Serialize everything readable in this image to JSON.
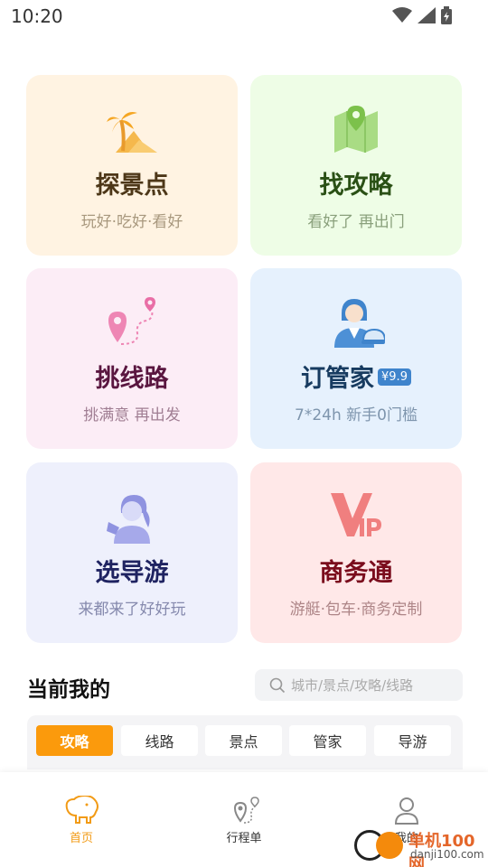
{
  "status_bar": {
    "time": "10:20"
  },
  "cards": [
    {
      "title": "探景点",
      "subtitle": "玩好·吃好·看好",
      "icon": "palm-tree-mountain-icon"
    },
    {
      "title": "找攻略",
      "subtitle": "看好了 再出门",
      "icon": "map-pin-icon"
    },
    {
      "title": "挑线路",
      "subtitle": "挑满意 再出发",
      "icon": "route-icon"
    },
    {
      "title": "订管家",
      "badge": "¥9.9",
      "subtitle": "7*24h 新手0门槛",
      "icon": "concierge-icon"
    },
    {
      "title": "选导游",
      "subtitle": "来都来了好好玩",
      "icon": "guide-icon"
    },
    {
      "title": "商务通",
      "subtitle": "游艇·包车·商务定制",
      "icon": "vip-icon"
    }
  ],
  "section": {
    "title": "当前我的",
    "search_placeholder": "城市/景点/攻略/线路"
  },
  "tabs": [
    {
      "label": "攻略",
      "active": true
    },
    {
      "label": "线路",
      "active": false
    },
    {
      "label": "景点",
      "active": false
    },
    {
      "label": "管家",
      "active": false
    },
    {
      "label": "导游",
      "active": false
    }
  ],
  "bottom_nav": [
    {
      "label": "首页",
      "icon": "elephant-home-icon",
      "active": true
    },
    {
      "label": "行程单",
      "icon": "itinerary-icon",
      "active": false
    },
    {
      "label": "我的",
      "icon": "profile-icon",
      "active": false
    }
  ],
  "watermark": {
    "title": "单机100网",
    "subtitle": "danji100.com"
  },
  "colors": {
    "accent": "#fb9a0c",
    "nav_active": "#f29b16"
  }
}
